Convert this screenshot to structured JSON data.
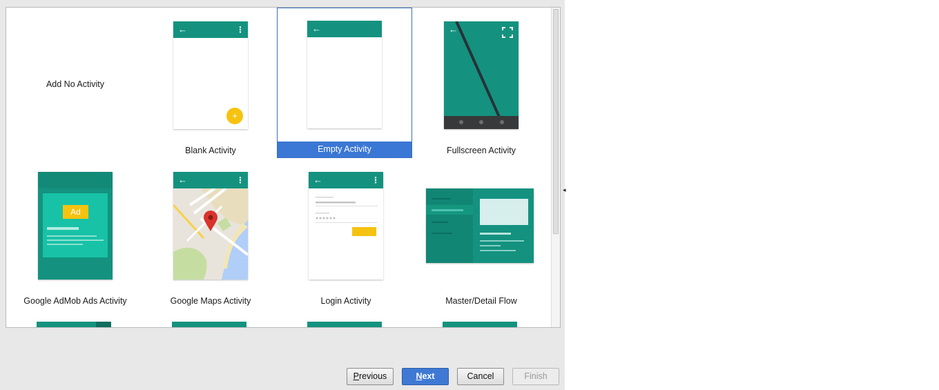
{
  "gallery": {
    "tiles": [
      {
        "label": "Add No Activity"
      },
      {
        "label": "Blank Activity"
      },
      {
        "label": "Empty Activity"
      },
      {
        "label": "Fullscreen Activity"
      },
      {
        "label": "Google AdMob Ads Activity",
        "badge": "Ad"
      },
      {
        "label": "Google Maps Activity"
      },
      {
        "label": "Login Activity"
      },
      {
        "label": "Master/Detail Flow"
      }
    ],
    "selected_index": 2
  },
  "icons": {
    "back": "back-arrow-icon",
    "menu": "overflow-menu-icon",
    "fab": "add-icon",
    "fullscreen": "fullscreen-icon"
  },
  "colors": {
    "teal": "#14927f",
    "accent_yellow": "#f5c30f",
    "selection_blue": "#3b77d4"
  },
  "footer": {
    "previous_mnemonic": "P",
    "previous_rest": "revious",
    "next_mnemonic": "N",
    "next_rest": "ext",
    "cancel": "Cancel",
    "finish": "Finish"
  }
}
